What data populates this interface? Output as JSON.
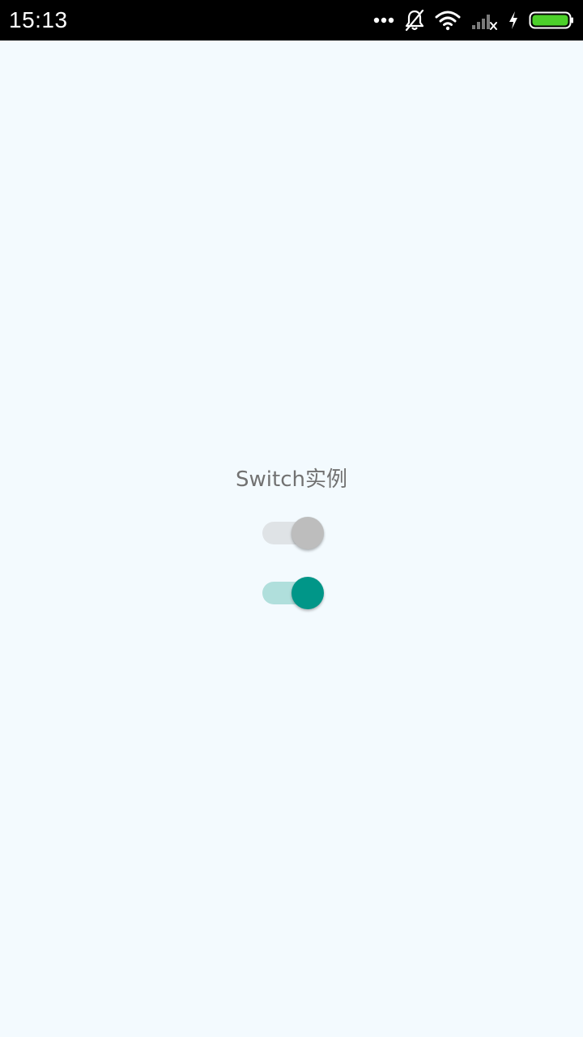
{
  "status_bar": {
    "time": "15:13",
    "icons": [
      "more-dots-icon",
      "notifications-off-icon",
      "wifi-icon",
      "signal-no-service-icon",
      "charging-bolt-icon",
      "battery-full-icon"
    ],
    "battery_color": "#4CD02A"
  },
  "main": {
    "title": "Switch实例",
    "switches": [
      {
        "name": "switch-1",
        "checked": false,
        "thumb_color": "#BDBDBD",
        "track_color": "#DFE3E6"
      },
      {
        "name": "switch-2",
        "checked": true,
        "thumb_color": "#009688",
        "track_color": "#B0DFDC"
      }
    ]
  },
  "colors": {
    "background": "#F3FAFE",
    "accent": "#009688",
    "title_text": "#727272"
  }
}
